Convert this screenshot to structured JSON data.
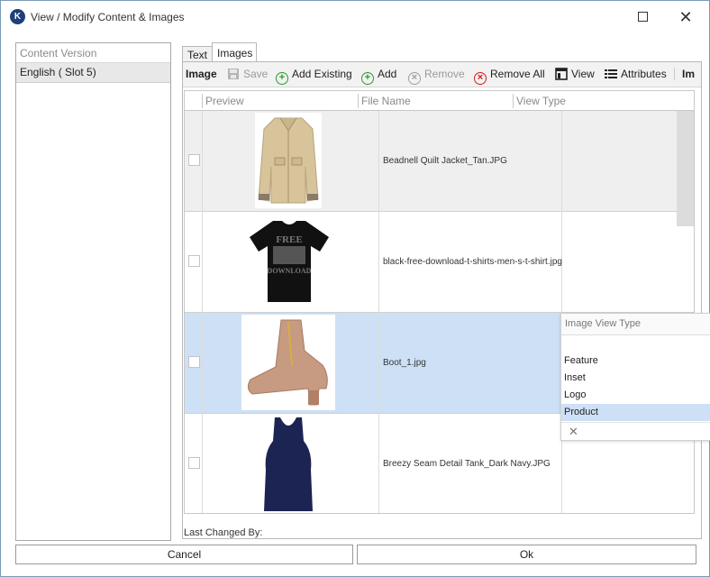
{
  "window": {
    "title": "View / Modify Content & Images",
    "app_icon_glyph": "K",
    "accent": "#1f3f7a"
  },
  "left_panel": {
    "header": "Content Version",
    "items": [
      {
        "label": "English ( Slot 5)"
      }
    ]
  },
  "tabs": [
    {
      "label": "Text"
    },
    {
      "label": "Images",
      "active": true
    }
  ],
  "toolbar": {
    "title": "Image",
    "save": "Save",
    "add_existing": "Add Existing",
    "add": "Add",
    "remove": "Remove",
    "remove_all": "Remove All",
    "view": "View",
    "attributes": "Attributes",
    "overflow": "Im"
  },
  "grid": {
    "columns": {
      "preview": "Preview",
      "file_name": "File Name",
      "view_type": "View Type"
    },
    "rows": [
      {
        "file_name": "Beadnell Quilt Jacket_Tan.JPG",
        "selected": false,
        "thumb": "tan quilted jacket"
      },
      {
        "file_name": "black-free-download-t-shirts-men-s-t-shirt.jpg",
        "selected": false,
        "thumb": "black t-shirt",
        "shirt_text_1": "FREE",
        "shirt_text_2": "DOWNLOAD"
      },
      {
        "file_name": "Boot_1.jpg",
        "selected": true,
        "thumb": "tan ankle boot"
      },
      {
        "file_name": "Breezy Seam Detail Tank_Dark Navy.JPG",
        "selected": false,
        "thumb": "navy tank top"
      }
    ]
  },
  "dropdown": {
    "header": "Image View Type",
    "options": [
      "Feature",
      "Inset",
      "Logo",
      "Product"
    ],
    "selected": "Product",
    "clear_glyph": "✕"
  },
  "footer": {
    "last_changed_label": "Last Changed By:"
  },
  "buttons": {
    "cancel": "Cancel",
    "ok": "Ok"
  }
}
